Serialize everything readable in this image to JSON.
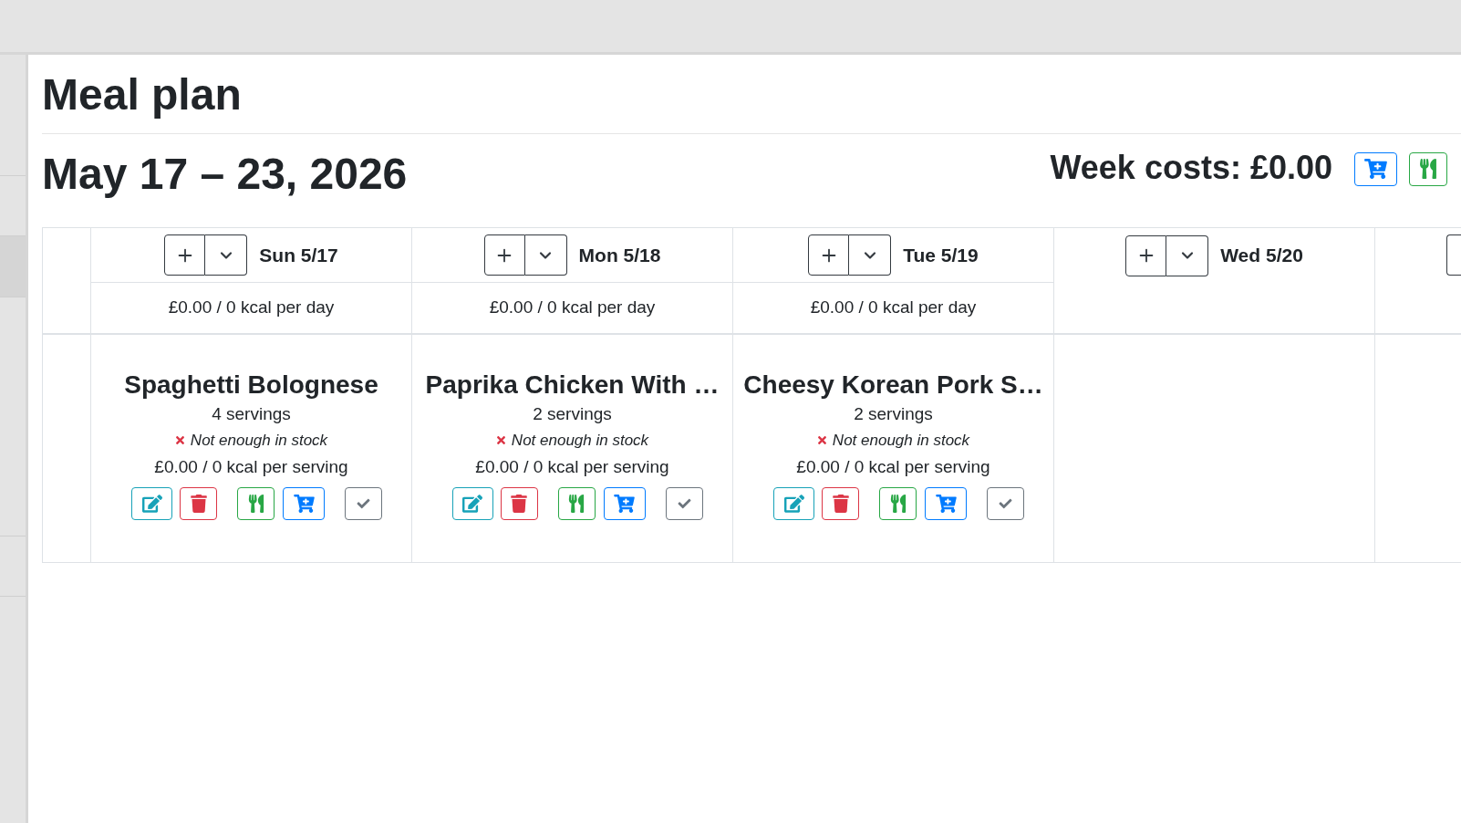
{
  "sidebar": {
    "items": [
      {
        "selected": false
      },
      {
        "selected": true
      },
      {
        "selected": false
      }
    ]
  },
  "header": {
    "title": "Meal plan",
    "week_range": "May 17 – 23, 2026",
    "week_costs": "Week costs: £0.00"
  },
  "days": [
    {
      "label": "Sun 5/17",
      "totals": "£0.00 / 0 kcal per day",
      "meals": [
        {
          "title": "Spaghetti Bolognese",
          "servings": "4 servings",
          "in_stock": false,
          "stock_text": "Not enough in stock",
          "costs": "£0.00 / 0 kcal per serving"
        }
      ]
    },
    {
      "label": "Mon 5/18",
      "totals": "£0.00 / 0 kcal per day",
      "meals": [
        {
          "title": "Paprika Chicken With …",
          "servings": "2 servings",
          "in_stock": false,
          "stock_text": "Not enough in stock",
          "costs": "£0.00 / 0 kcal per serving"
        }
      ]
    },
    {
      "label": "Tue 5/19",
      "totals": "£0.00 / 0 kcal per day",
      "meals": [
        {
          "title": "Cheesy Korean Pork S…",
          "servings": "2 servings",
          "in_stock": false,
          "stock_text": "Not enough in stock",
          "costs": "£0.00 / 0 kcal per serving"
        }
      ]
    },
    {
      "label": "Wed 5/20"
    }
  ]
}
